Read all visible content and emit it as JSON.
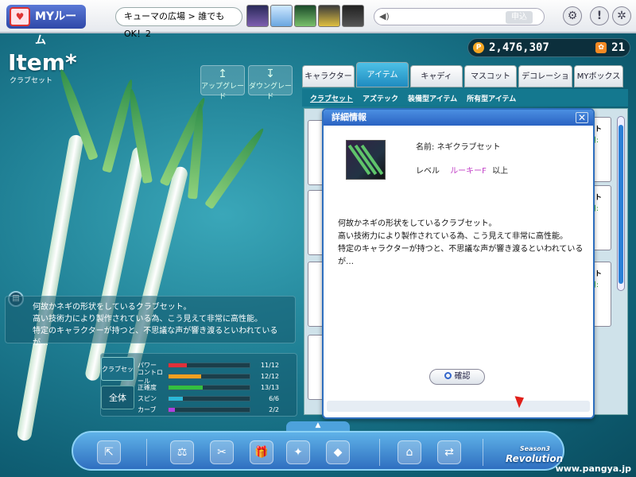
{
  "topbar": {
    "logo": "MYルーム",
    "breadcrumb": "キューマの広場 > 誰でもOK！2",
    "chat_send": "申込"
  },
  "currency": {
    "pang": "2,476,307",
    "points": "21"
  },
  "page": {
    "title": "Item*",
    "subtitle": "クラブセット",
    "upgrade": "アップグレード",
    "downgrade": "ダウングレード"
  },
  "description": {
    "lines": [
      "何故かネギの形状をしているクラブセット。",
      "高い技術力により製作されている為、こう見えて非常に高性能。",
      "特定のキャラクターが持つと、不思議な声が響き渡るといわれているが…"
    ]
  },
  "stats": {
    "tag": "クラブセット",
    "all": "全体",
    "rows": [
      {
        "label": "パワー",
        "value": "11/12",
        "color": "#e0303a"
      },
      {
        "label": "コントロール",
        "value": "12/12",
        "color": "#f0a020"
      },
      {
        "label": "正確度",
        "value": "13/13",
        "color": "#33c040"
      },
      {
        "label": "スピン",
        "value": "6/6",
        "color": "#2bb8d8"
      },
      {
        "label": "カーブ",
        "value": "2/2",
        "color": "#b040e0"
      }
    ]
  },
  "tabs": [
    "キャラクター",
    "アイテム",
    "キャディ",
    "マスコット",
    "デコレーション",
    "MYボックス"
  ],
  "subtabs": [
    "クラブセット",
    "アズテック",
    "装備型アイテム",
    "所有型アイテム"
  ],
  "list": {
    "card_labels": [
      "ット",
      "ット",
      "ット"
    ],
    "card_sub": [
      "用:",
      "P",
      "用:",
      "P",
      "用:",
      "P"
    ]
  },
  "modal": {
    "title": "詳細情報",
    "name_label": "名前",
    "name": "ネギクラブセット",
    "level_label": "レベル",
    "level": "ルーキーF",
    "level_suffix": "以上",
    "desc": [
      "何故かネギの形状をしているクラブセット。",
      "高い技術力により製作されている為、こう見えて非常に高性能。",
      "特定のキャラクターが持つと、不思議な声が響き渡るといわれているが…"
    ],
    "confirm": "確認"
  },
  "brand": {
    "name": "Revolution",
    "season": "Season3",
    "url": "www.pangya.jp"
  }
}
